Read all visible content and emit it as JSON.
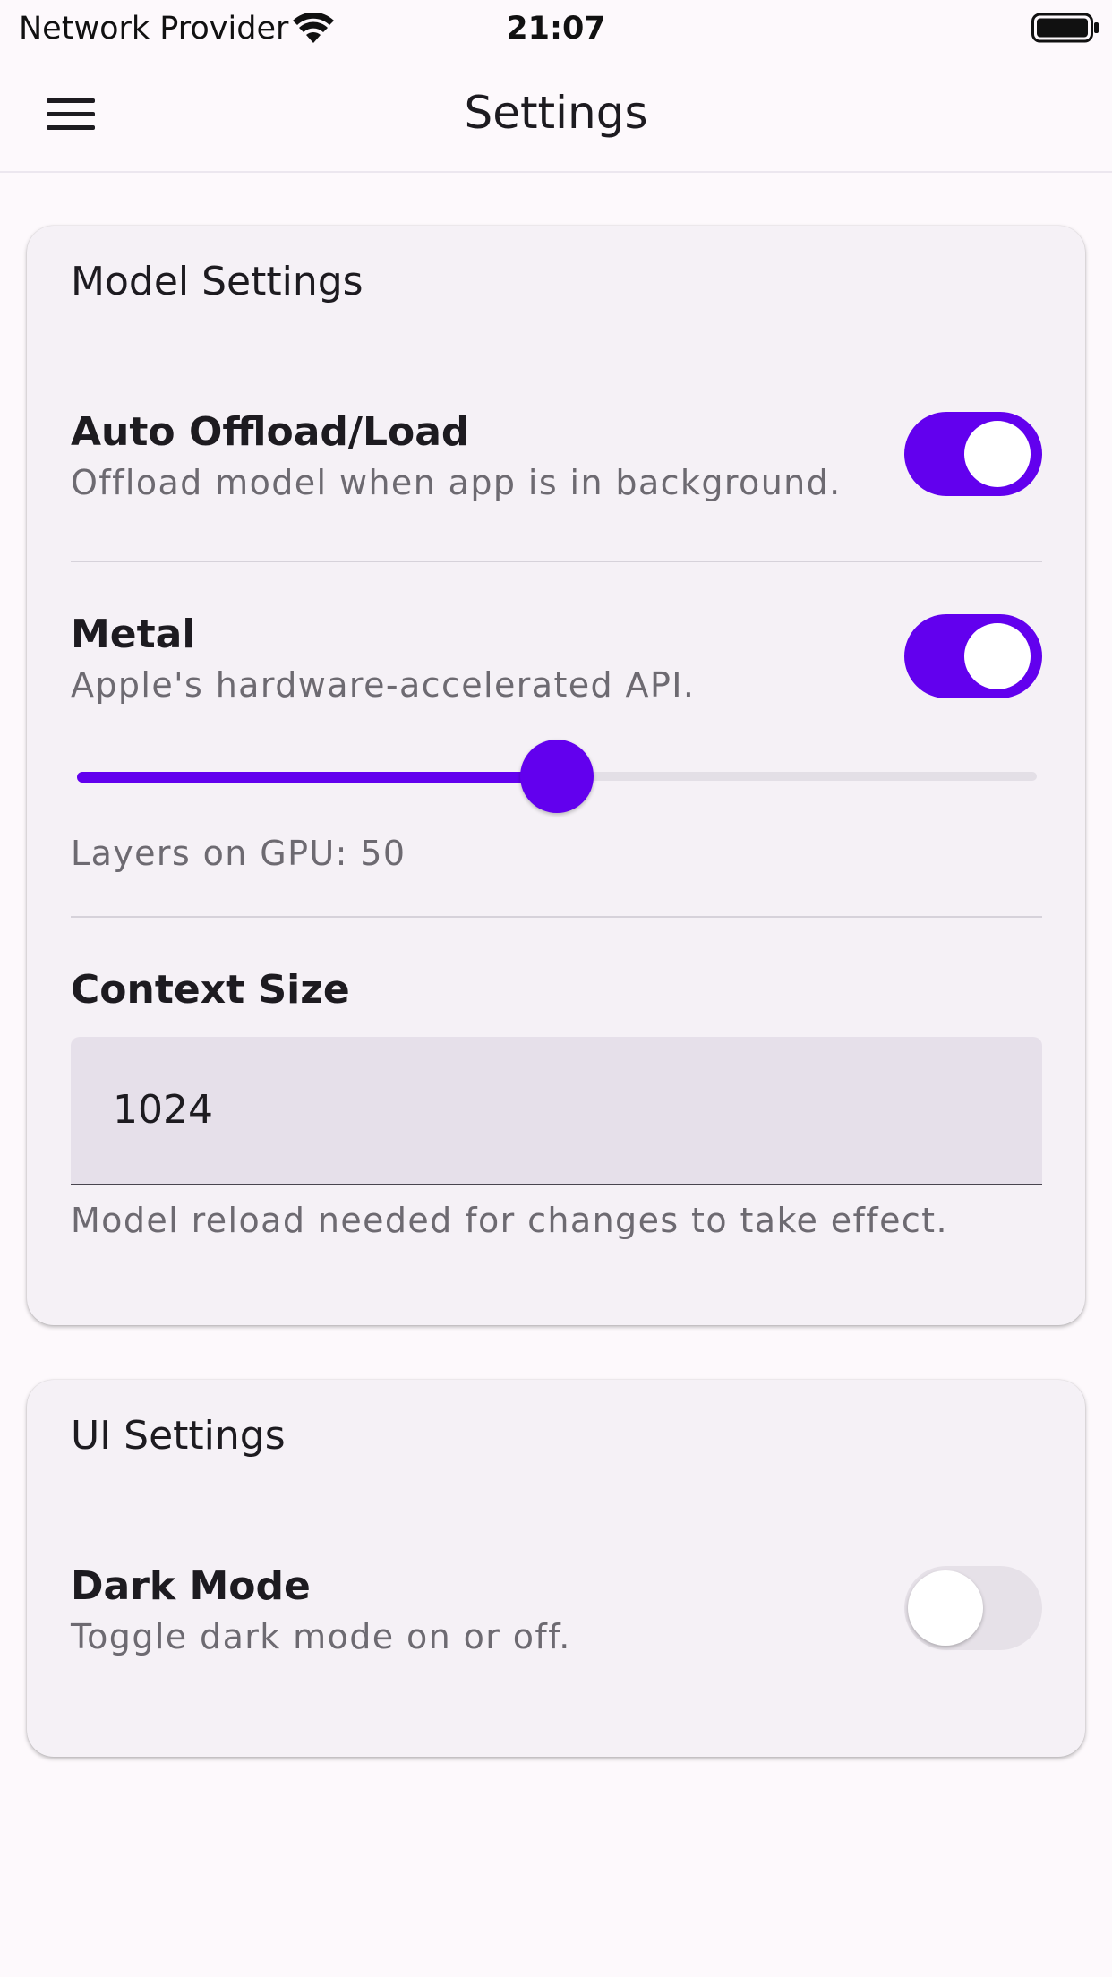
{
  "status_bar": {
    "carrier": "Network Provider",
    "time": "21:07",
    "wifi_icon": "wifi-icon",
    "battery_icon": "battery-icon"
  },
  "app_bar": {
    "title": "Settings",
    "menu_icon": "menu-icon"
  },
  "model_settings": {
    "title": "Model Settings",
    "auto_offload": {
      "label": "Auto Offload/Load",
      "description": "Offload model when app is in background.",
      "enabled": true
    },
    "metal": {
      "label": "Metal",
      "description": "Apple's hardware-accelerated API.",
      "enabled": true
    },
    "gpu_layers": {
      "caption": "Layers on GPU: 50",
      "value": 50,
      "fraction": 0.5
    },
    "context_size": {
      "label": "Context Size",
      "value": "1024",
      "helper": "Model reload needed for changes to take effect."
    }
  },
  "ui_settings": {
    "title": "UI Settings",
    "dark_mode": {
      "label": "Dark Mode",
      "description": "Toggle dark mode on or off.",
      "enabled": false
    }
  },
  "colors": {
    "accent": "#6200ee",
    "background": "#fdf9fc",
    "card": "#f5f1f6",
    "field": "#e6e0ea",
    "secondary_text": "#6d6a71"
  }
}
